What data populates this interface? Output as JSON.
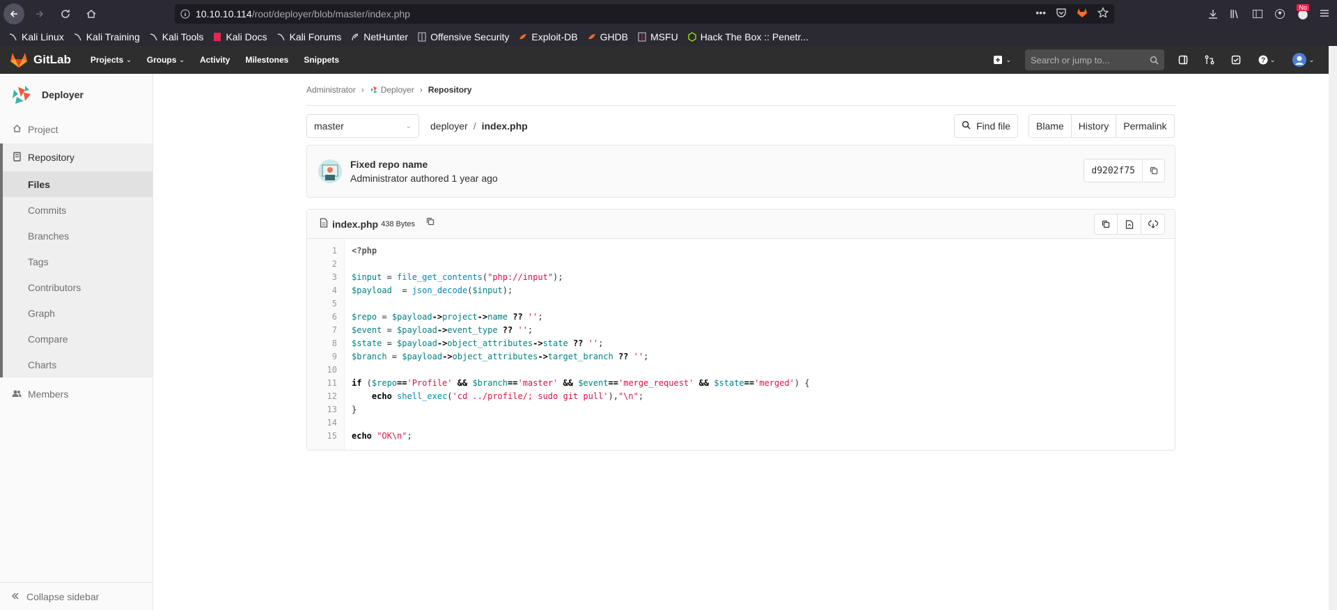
{
  "browser": {
    "url_host": "10.10.10.114",
    "url_path": "/root/deployer/blob/master/index.php",
    "badge": "No",
    "bookmarks": [
      {
        "label": "Kali Linux"
      },
      {
        "label": "Kali Training"
      },
      {
        "label": "Kali Tools"
      },
      {
        "label": "Kali Docs"
      },
      {
        "label": "Kali Forums"
      },
      {
        "label": "NetHunter"
      },
      {
        "label": "Offensive Security"
      },
      {
        "label": "Exploit-DB"
      },
      {
        "label": "GHDB"
      },
      {
        "label": "MSFU"
      },
      {
        "label": "Hack The Box :: Penetr..."
      }
    ]
  },
  "header": {
    "brand": "GitLab",
    "nav": [
      "Projects",
      "Groups",
      "Activity",
      "Milestones",
      "Snippets"
    ],
    "search_placeholder": "Search or jump to..."
  },
  "sidebar": {
    "project_name": "Deployer",
    "project": "Project",
    "repository": "Repository",
    "repo_items": [
      "Files",
      "Commits",
      "Branches",
      "Tags",
      "Contributors",
      "Graph",
      "Compare",
      "Charts"
    ],
    "members": "Members",
    "collapse": "Collapse sidebar"
  },
  "breadcrumb": {
    "a": "Administrator",
    "b": "Deployer",
    "c": "Repository"
  },
  "file_nav": {
    "branch": "master",
    "dir": "deployer",
    "file": "index.php",
    "find_file": "Find file",
    "blame": "Blame",
    "history": "History",
    "permalink": "Permalink"
  },
  "commit": {
    "title": "Fixed repo name",
    "meta": "Administrator authored 1 year ago",
    "sha": "d9202f75"
  },
  "file": {
    "name": "index.php",
    "size": "438 Bytes"
  },
  "code_lines": [
    "<?php",
    "",
    "$input = file_get_contents(\"php://input\");",
    "$payload  = json_decode($input);",
    "",
    "$repo = $payload->project->name ?? '';",
    "$event = $payload->event_type ?? '';",
    "$state = $payload->object_attributes->state ?? '';",
    "$branch = $payload->object_attributes->target_branch ?? '';",
    "",
    "if ($repo=='Profile' && $branch=='master' && $event=='merge_request' && $state=='merged') {",
    "    echo shell_exec('cd ../profile/; sudo git pull'),\"\\n\";",
    "}",
    "",
    "echo \"OK\\n\";"
  ]
}
